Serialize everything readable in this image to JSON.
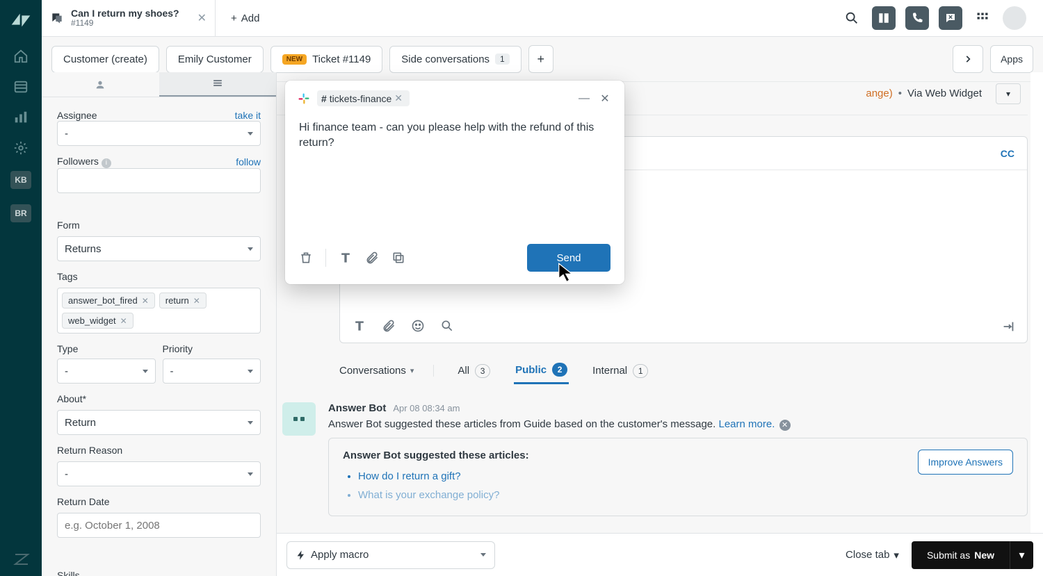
{
  "app": {
    "tab_title": "Can I return my shoes?",
    "tab_ticket_id": "#1149",
    "add_tab_label": "Add"
  },
  "left_rail": {
    "kb_label": "KB",
    "br_label": "BR"
  },
  "sec_tabs": {
    "customer_create": "Customer (create)",
    "emily_customer": "Emily Customer",
    "ticket_badge": "NEW",
    "ticket_label": "Ticket #1149",
    "side_conv_label": "Side conversations",
    "side_conv_count": "1",
    "apps_label": "Apps"
  },
  "details": {
    "assignee_label": "Assignee",
    "take_it": "take it",
    "assignee_value": "-",
    "followers_label": "Followers",
    "follow": "follow",
    "form_label": "Form",
    "form_value": "Returns",
    "tags_label": "Tags",
    "tags": [
      "answer_bot_fired",
      "return",
      "web_widget"
    ],
    "type_label": "Type",
    "type_value": "-",
    "priority_label": "Priority",
    "priority_value": "-",
    "about_label": "About*",
    "about_value": "Return",
    "return_reason_label": "Return Reason",
    "return_reason_value": "-",
    "return_date_label": "Return Date",
    "return_date_placeholder": "e.g. October 1, 2008",
    "skills_label": "Skills"
  },
  "header_meta": {
    "orange_suffix": "ange)",
    "via": "Via Web Widget"
  },
  "compose": {
    "cc_label": "CC"
  },
  "conversations": {
    "dropdown_label": "Conversations",
    "all_label": "All",
    "all_count": "3",
    "public_label": "Public",
    "public_count": "2",
    "internal_label": "Internal",
    "internal_count": "1"
  },
  "bot": {
    "name": "Answer Bot",
    "timestamp": "Apr 08 08:34 am",
    "line1": "Answer Bot suggested these articles from Guide based on the customer's message.",
    "learn_more": "Learn more.",
    "card_heading": "Answer Bot suggested these articles:",
    "article1": "How do I return a gift?",
    "article2": "What is your exchange policy?",
    "improve_label": "Improve Answers"
  },
  "footer": {
    "apply_macro": "Apply macro",
    "close_tab": "Close tab",
    "submit_prefix": "Submit as",
    "submit_status": "New"
  },
  "popover": {
    "channel": "tickets-finance",
    "body": "Hi finance team - can you please help with the refund of this return?",
    "send_label": "Send"
  }
}
